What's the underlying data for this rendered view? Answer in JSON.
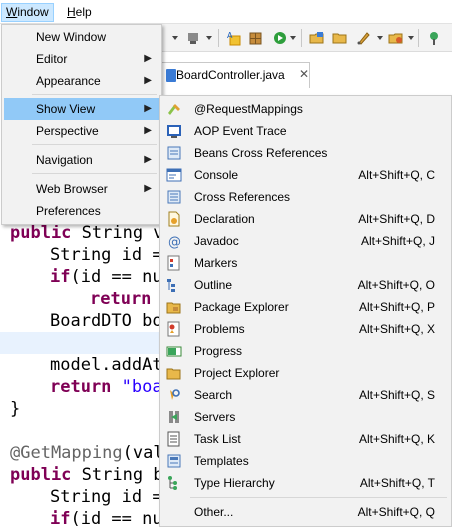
{
  "menubar": {
    "window_label_prefix": "W",
    "window_label_rest": "indow",
    "help_label_prefix": "H",
    "help_label_rest": "elp"
  },
  "editor": {
    "tab_title": "BoardController.java",
    "tab_close": "✕",
    "code_lines": [
      {
        "kw": "public",
        "text": " String v"
      },
      {
        "text": "String id ="
      },
      {
        "kw": "if",
        "text": "(id == nu"
      },
      {
        "kw": "return",
        "text": " "
      },
      {
        "text": "BoardDTO bo"
      },
      {
        "text": ""
      },
      {
        "text": "model.addAt"
      },
      {
        "kw": "return",
        "text": " \"boa"
      },
      {
        "text": "}"
      },
      {
        "text": ""
      },
      {
        "ann": "@GetMapping",
        "text": "(val"
      },
      {
        "kw": "public",
        "text": " String b"
      },
      {
        "text": "String id ="
      },
      {
        "kw": "if",
        "text": "(id == nu"
      }
    ]
  },
  "window_menu": {
    "items": [
      {
        "label": "New Window",
        "submenu": false
      },
      {
        "label": "Editor",
        "submenu": true
      },
      {
        "label": "Appearance",
        "submenu": true
      },
      {
        "label": "Show View",
        "submenu": true,
        "highlighted": true
      },
      {
        "label": "Perspective",
        "submenu": true
      },
      {
        "label": "Navigation",
        "submenu": true
      },
      {
        "label": "Web Browser",
        "submenu": true
      },
      {
        "label": "Preferences",
        "submenu": false
      }
    ],
    "submenu_arrow": "▶"
  },
  "show_view_menu": {
    "items": [
      {
        "label": "@RequestMappings",
        "accel": "",
        "icon": "request-mappings-icon"
      },
      {
        "label": "AOP Event Trace",
        "accel": "",
        "icon": "aop-event-trace-icon"
      },
      {
        "label": "Beans Cross References",
        "accel": "",
        "icon": "beans-cross-references-icon"
      },
      {
        "label": "Console",
        "accel": "Alt+Shift+Q, C",
        "icon": "console-icon"
      },
      {
        "label": "Cross References",
        "accel": "",
        "icon": "cross-references-icon"
      },
      {
        "label": "Declaration",
        "accel": "Alt+Shift+Q, D",
        "icon": "declaration-icon"
      },
      {
        "label": "Javadoc",
        "accel": "Alt+Shift+Q, J",
        "icon": "javadoc-icon"
      },
      {
        "label": "Markers",
        "accel": "",
        "icon": "markers-icon"
      },
      {
        "label": "Outline",
        "accel": "Alt+Shift+Q, O",
        "icon": "outline-icon"
      },
      {
        "label": "Package Explorer",
        "accel": "Alt+Shift+Q, P",
        "icon": "package-explorer-icon"
      },
      {
        "label": "Problems",
        "accel": "Alt+Shift+Q, X",
        "icon": "problems-icon"
      },
      {
        "label": "Progress",
        "accel": "",
        "icon": "progress-icon"
      },
      {
        "label": "Project Explorer",
        "accel": "",
        "icon": "project-explorer-icon"
      },
      {
        "label": "Search",
        "accel": "Alt+Shift+Q, S",
        "icon": "search-icon"
      },
      {
        "label": "Servers",
        "accel": "",
        "icon": "servers-icon"
      },
      {
        "label": "Task List",
        "accel": "Alt+Shift+Q, K",
        "icon": "task-list-icon"
      },
      {
        "label": "Templates",
        "accel": "",
        "icon": "templates-icon"
      },
      {
        "label": "Type Hierarchy",
        "accel": "Alt+Shift+Q, T",
        "icon": "type-hierarchy-icon"
      },
      {
        "label": "Other...",
        "accel": "Alt+Shift+Q, Q",
        "icon": ""
      }
    ]
  },
  "colors": {
    "menu_background": "#f2f2f2",
    "menu_highlight": "#91c9f7",
    "menubar_active": "#cce8ff",
    "keyword": "#7f0055",
    "string": "#2a00ff",
    "annotation": "#646464"
  }
}
